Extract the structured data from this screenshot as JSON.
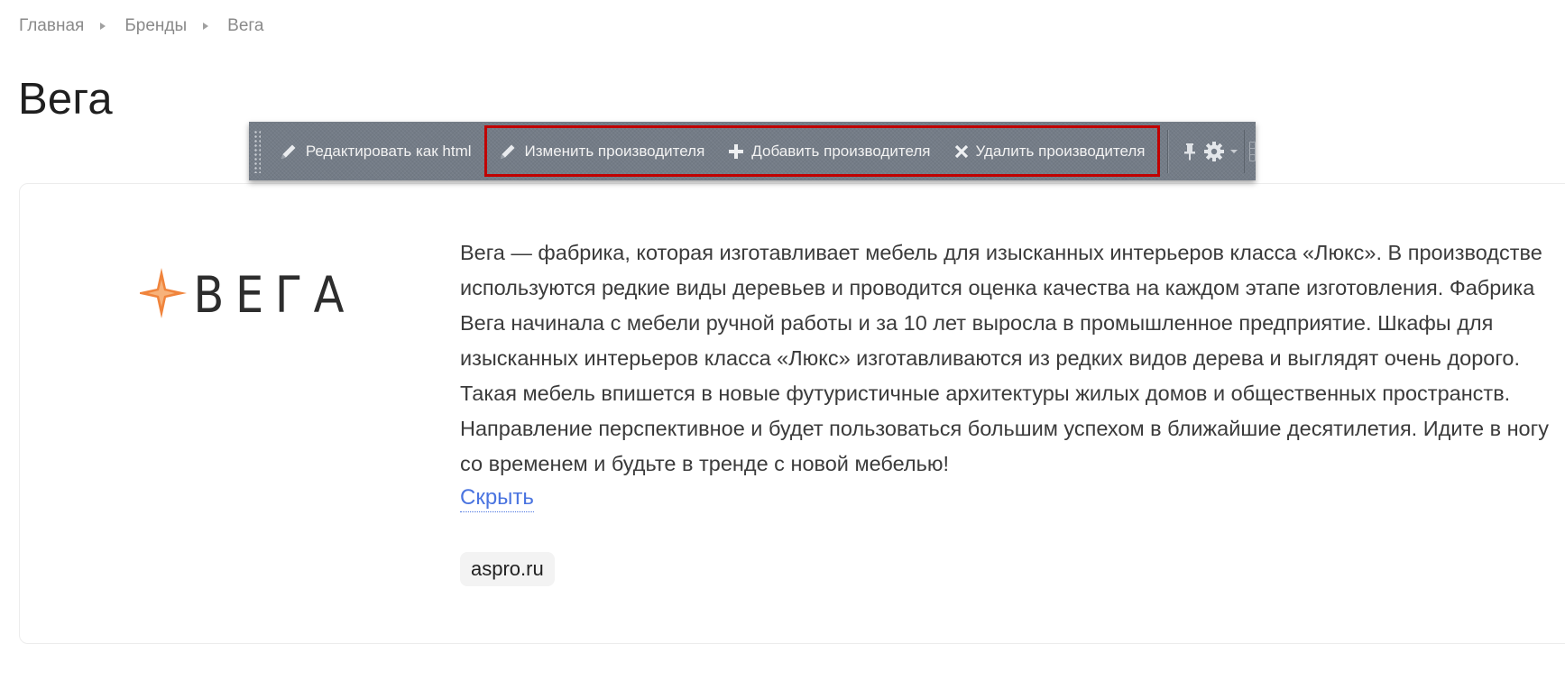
{
  "breadcrumbs": [
    "Главная",
    "Бренды",
    "Вега"
  ],
  "page_title": "Вега",
  "admin_toolbar": {
    "edit_html": "Редактировать как html",
    "edit_brand": "Изменить производителя",
    "add_brand": "Добавить производителя",
    "delete_brand": "Удалить производителя",
    "icons": [
      "pencil-icon",
      "pencil-icon",
      "plus-icon",
      "close-icon",
      "pin-icon",
      "gear-icon",
      "chevron-down-icon"
    ],
    "highlight_color": "#c10000"
  },
  "brand": {
    "logo_text": "ВЕГА",
    "logo_colors": [
      "#f0843c",
      "#f7b27a",
      "#2d2d2d"
    ],
    "description": "Вега — фабрика, которая изготавливает мебель для изысканных интерьеров класса «Люкс». В производстве используются редкие виды деревьев и проводится оценка качества на каждом этапе изготовления. Фабрика Вега начинала с мебели ручной работы и за 10 лет выросла в промышленное предприятие. Шкафы для изысканных интерьеров класса «Люкс» изготавливаются из редких видов дерева и выглядят очень дорого. Такая мебель впишется в новые футуристичные архитектуры жилых домов и общественных пространств. Направление перспективное и будет пользоваться большим успехом в ближайшие десятилетия. Идите в ногу со временем и будьте в тренде с новой мебелью!",
    "hide_link": "Скрыть",
    "site": "aspro.ru"
  },
  "colors": {
    "link": "#4a74e0",
    "toolbar_bg": "#747c87"
  }
}
